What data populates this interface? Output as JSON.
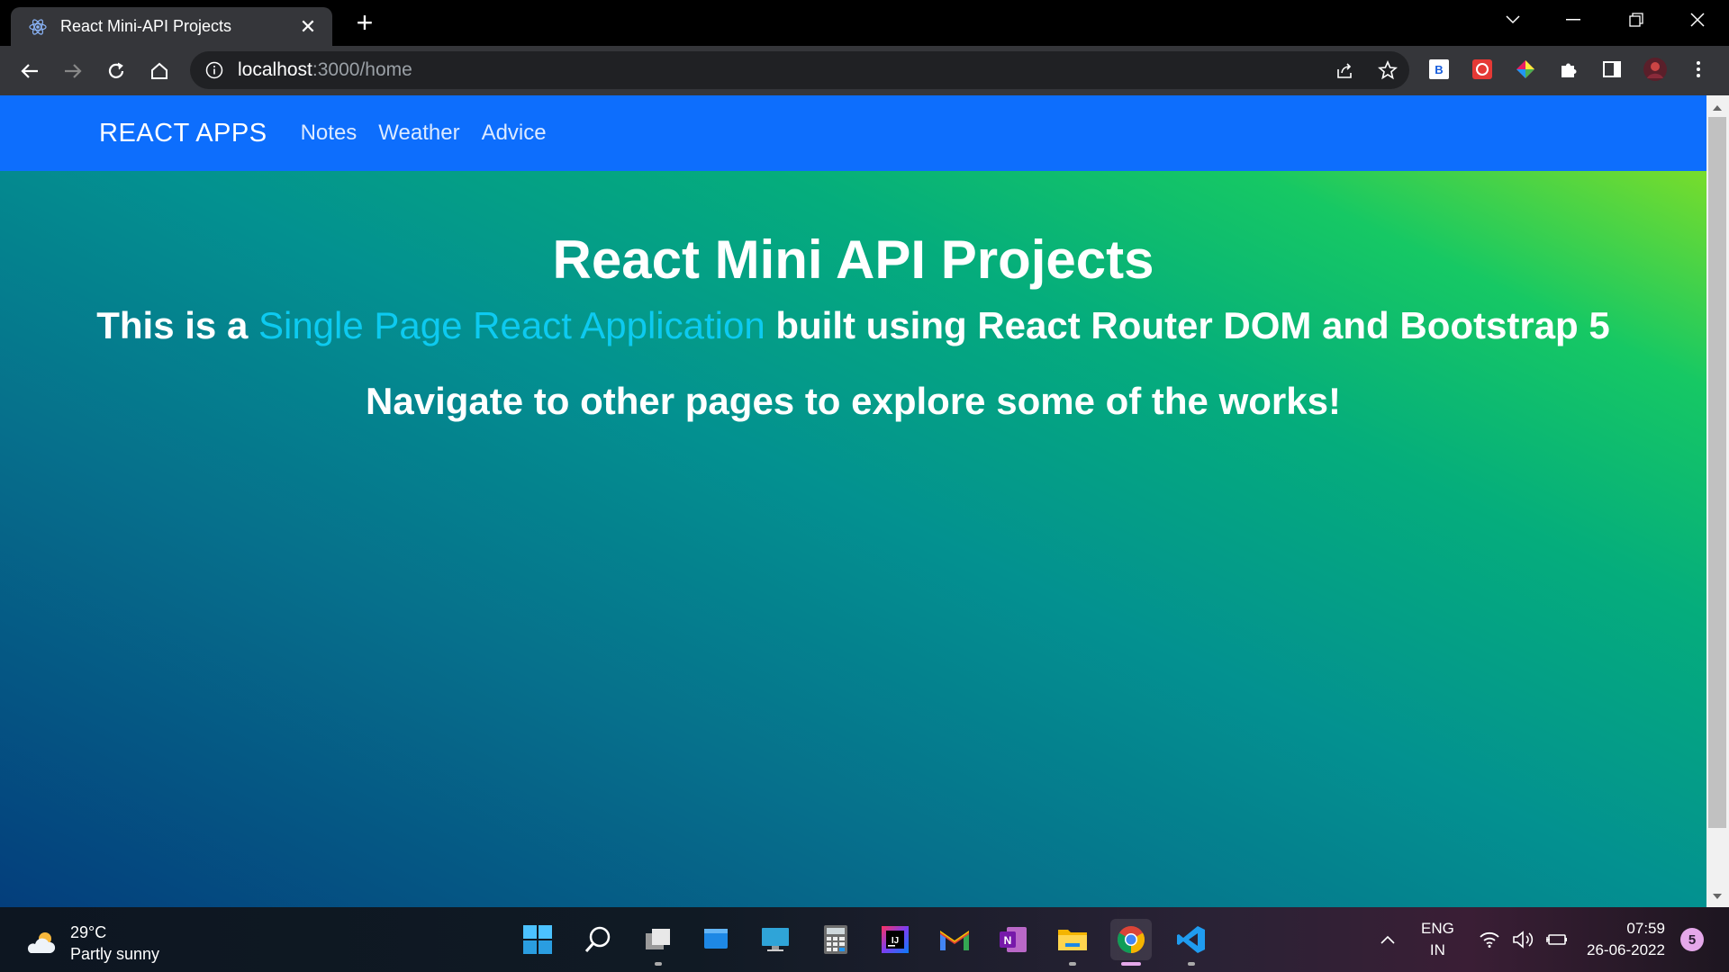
{
  "browser": {
    "tab_title": "React Mini-API Projects",
    "url_host": "localhost",
    "url_path": ":3000/home",
    "extensions": [
      "bitwarden-icon",
      "extension-red-icon",
      "color-picker-icon",
      "puzzle-icon",
      "sidebar-icon",
      "profile-avatar"
    ]
  },
  "navbar": {
    "brand": "REACT APPS",
    "links": [
      "Notes",
      "Weather",
      "Advice"
    ]
  },
  "hero": {
    "title": "React Mini API Projects",
    "sub_prefix": "This is a ",
    "sub_highlight": "Single Page React Application",
    "sub_suffix": " built using React Router DOM and Bootstrap 5",
    "navigate": "Navigate to other pages to explore some of the works!"
  },
  "taskbar": {
    "weather_temp": "29°C",
    "weather_desc": "Partly sunny",
    "lang_top": "ENG",
    "lang_bottom": "IN",
    "time": "07:59",
    "date": "26-06-2022",
    "notification_count": "5"
  },
  "colors": {
    "navbar_bg": "#0d6efd",
    "highlight": "#0dcaf0"
  }
}
